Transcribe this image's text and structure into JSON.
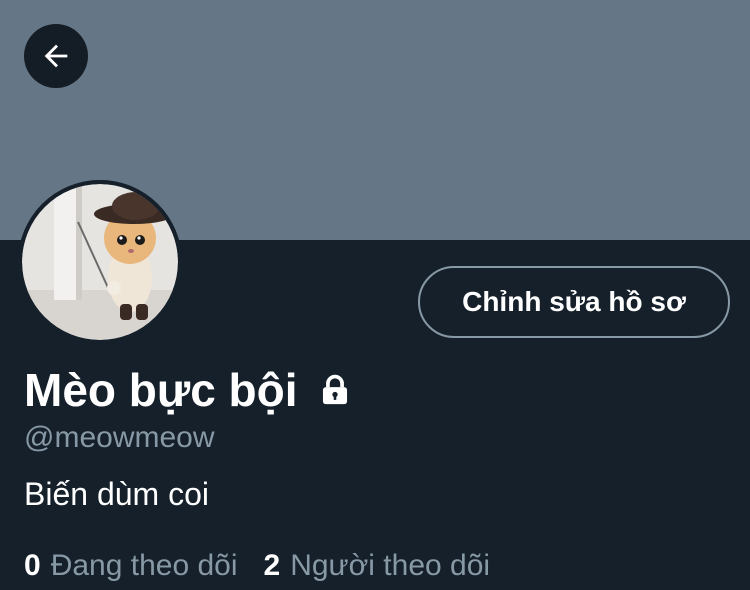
{
  "profile": {
    "edit_button_label": "Chỉnh sửa hồ sơ",
    "display_name": "Mèo bực bội",
    "handle": "@meowmeow",
    "bio": "Biến dùm coi",
    "following_count": "0",
    "following_label": "Đang theo dõi",
    "followers_count": "2",
    "followers_label": "Người theo dõi"
  },
  "icons": {
    "back": "arrow-left-icon",
    "lock": "lock-icon"
  },
  "colors": {
    "background": "#15202b",
    "banner": "#657786",
    "primary_text": "#ffffff",
    "secondary_text": "#8899a6",
    "button_border": "#8899a6"
  }
}
